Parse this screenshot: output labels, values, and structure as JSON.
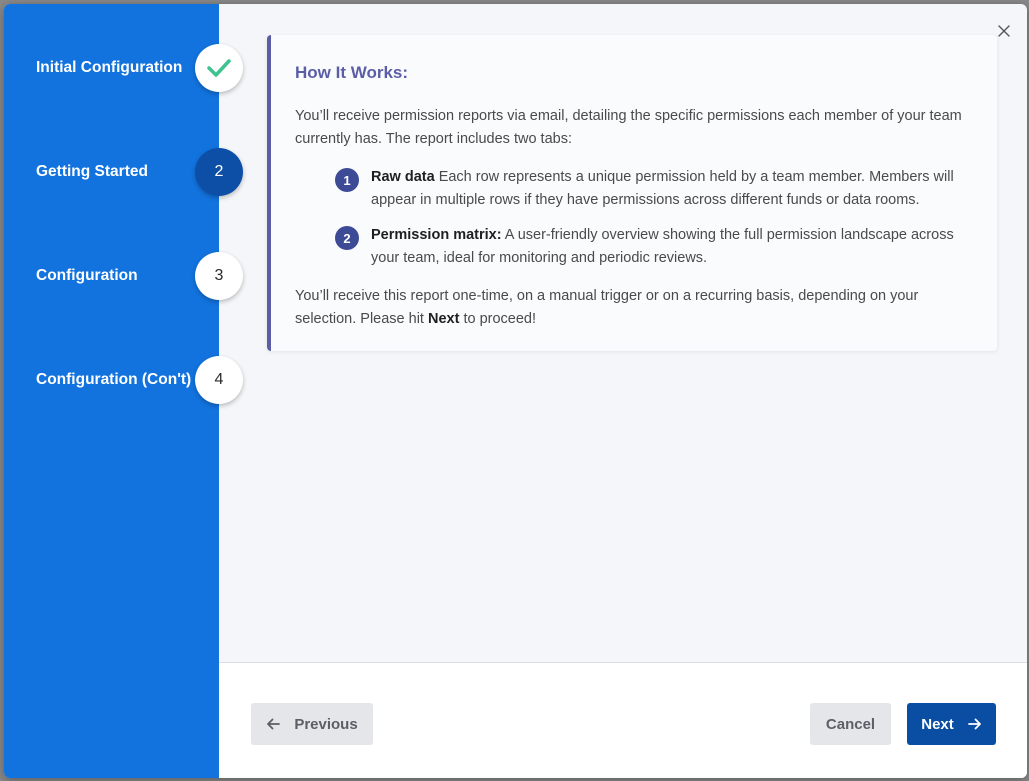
{
  "colors": {
    "sidebar": "#1273de",
    "active_step": "#0d4fa6",
    "check": "#3ec28f",
    "card_accent": "#5b5ea6",
    "next_button": "#0a4ea3"
  },
  "steps": [
    {
      "label": "Initial Configuration",
      "marker": "",
      "state": "completed",
      "icon": "check-icon"
    },
    {
      "label": "Getting Started",
      "marker": "2",
      "state": "active"
    },
    {
      "label": "Configuration",
      "marker": "3",
      "state": "pending"
    },
    {
      "label": "Configuration (Con't)",
      "marker": "4",
      "state": "pending"
    }
  ],
  "close_icon": "close-icon",
  "card": {
    "title": "How It Works:",
    "intro": "You’ll receive permission reports via email, detailing the specific permissions each member of your team currently has. The report includes two tabs:",
    "items": [
      {
        "num": "1",
        "title": "Raw data",
        "text": " Each row represents a unique permission held by a team member. Members will appear in multiple rows if they have permissions across different funds or data rooms."
      },
      {
        "num": "2",
        "title": "Permission matrix:",
        "text": " A user-friendly overview showing the full permission landscape across your team, ideal for monitoring and periodic reviews."
      }
    ],
    "outro_before": "You’ll receive this report one-time, on a manual trigger or on a recurring basis, depending on your selection. Please hit ",
    "outro_bold": "Next",
    "outro_after": " to proceed!"
  },
  "footer": {
    "previous_label": "Previous",
    "previous_icon": "arrow-left-icon",
    "cancel_label": "Cancel",
    "next_label": "Next",
    "next_icon": "arrow-right-icon"
  }
}
